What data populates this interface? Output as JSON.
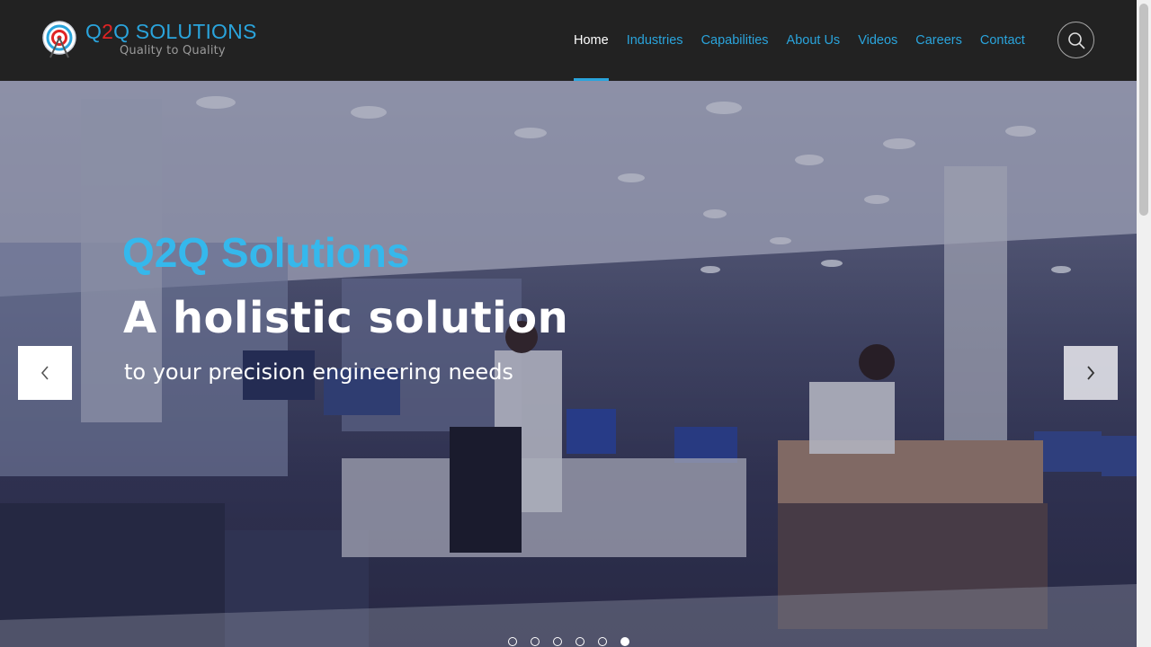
{
  "brand": {
    "name_part1": "Q",
    "name_part2": "2",
    "name_part3": "Q SOLUTIONS",
    "tagline": "Quality to Quality",
    "accent_color": "#2aa4dc",
    "highlight_color": "#e02424"
  },
  "nav": {
    "items": [
      {
        "label": "Home",
        "active": true
      },
      {
        "label": "Industries",
        "active": false
      },
      {
        "label": "Capabilities",
        "active": false
      },
      {
        "label": "About Us",
        "active": false
      },
      {
        "label": "Videos",
        "active": false
      },
      {
        "label": "Careers",
        "active": false
      },
      {
        "label": "Contact",
        "active": false
      }
    ],
    "search_icon": "search-icon"
  },
  "hero": {
    "kicker": "Q2Q Solutions",
    "title": "A holistic solution",
    "subtitle": "to your precision engineering needs",
    "prev_icon": "chevron-left-icon",
    "next_icon": "chevron-right-icon",
    "slides_total": 6,
    "active_slide": 6,
    "kicker_color": "#35b8ec"
  }
}
